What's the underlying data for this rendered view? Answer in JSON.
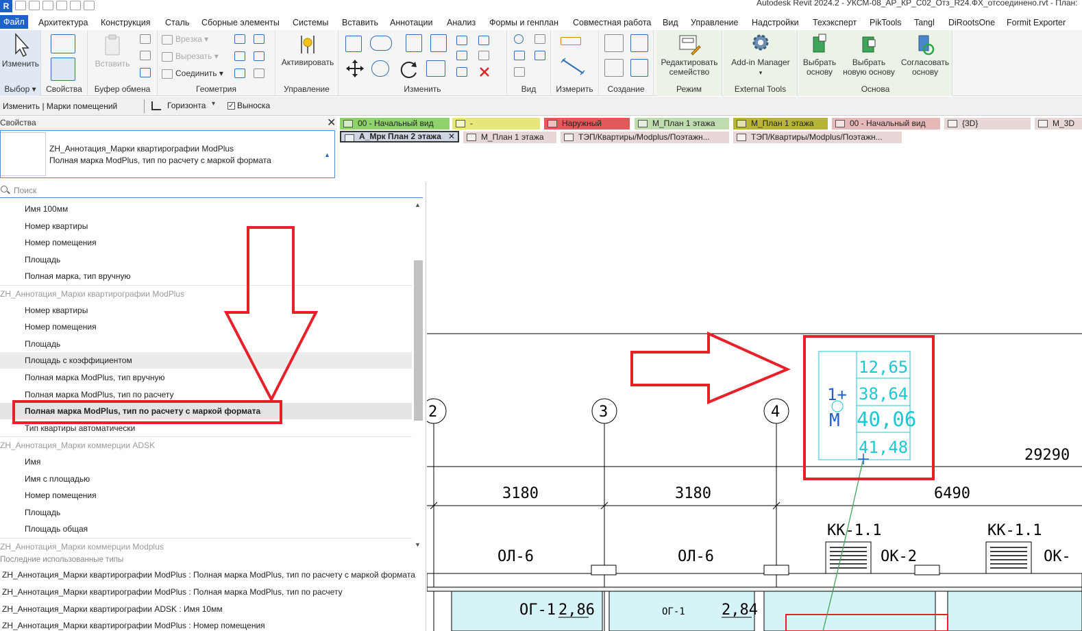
{
  "titlebar": {
    "app_logo": "R",
    "title": "Autodesk Revit 2024.2 - УКСМ-08_АР_КР_С02_Отз_R24.ФХ_отсоединено.rvt - План:"
  },
  "menu": {
    "tabs": [
      "Файл",
      "Архитектура",
      "Конструкция",
      "Сталь",
      "Сборные элементы",
      "Системы",
      "Вставить",
      "Аннотации",
      "Анализ",
      "Формы и генплан",
      "Совместная работа",
      "Вид",
      "Управление",
      "Надстройки",
      "Техэксперт",
      "PikTools",
      "Tangl",
      "DiRootsOne",
      "Formit Exporter"
    ]
  },
  "ribbon": {
    "select": {
      "modify_label": "Изменить",
      "panel_label": "Выбор ▾"
    },
    "properties": {
      "panel_label": "Свойства"
    },
    "clipboard": {
      "paste_label": "Вставить",
      "panel_label": "Буфер обмена"
    },
    "geometry": {
      "cut_label": "Врезка",
      "uncut_label": "Вырезать",
      "join_label": "Соединить",
      "panel_label": "Геометрия"
    },
    "control": {
      "activate_label": "Активировать",
      "panel_label": "Управление"
    },
    "modify": {
      "panel_label": "Изменить"
    },
    "view": {
      "panel_label": "Вид"
    },
    "measure": {
      "panel_label": "Измерить"
    },
    "create": {
      "panel_label": "Создание"
    },
    "mode": {
      "edit_family_label": "Редактировать семейство",
      "panel_label": "Режим"
    },
    "external": {
      "addin_label": "Add-in Manager",
      "panel_label": "External Tools"
    },
    "basis": {
      "pick_label": "Выбрать основу",
      "pick_new_label": "Выбрать новую основу",
      "reconcile_label": "Согласовать основу",
      "panel_label": "Основа"
    }
  },
  "optbar": {
    "context": "Изменить | Марки помещений",
    "orientation": "Горизонта",
    "leader_label": "Выноска",
    "leader_checked": true
  },
  "properties": {
    "title": "Свойства",
    "family": "ZH_Аннотация_Марки квартирографии ModPlus",
    "type": "Полная марка ModPlus, тип по расчету с маркой формата",
    "search_placeholder": "Поиск",
    "items": [
      {
        "label": "Имя 100мм",
        "kind": "item"
      },
      {
        "label": "Номер квартиры",
        "kind": "item"
      },
      {
        "label": "Номер помещения",
        "kind": "item"
      },
      {
        "label": "Площадь",
        "kind": "item"
      },
      {
        "label": "Полная марка, тип вручную",
        "kind": "item"
      },
      {
        "label": "ZH_Аннотация_Марки квартирографии ModPlus",
        "kind": "group"
      },
      {
        "label": "Номер квартиры",
        "kind": "item"
      },
      {
        "label": "Номер помещения",
        "kind": "item"
      },
      {
        "label": "Площадь",
        "kind": "item"
      },
      {
        "label": "Площадь с коэффициентом",
        "kind": "hover"
      },
      {
        "label": "Полная марка ModPlus, тип вручную",
        "kind": "item"
      },
      {
        "label": "Полная марка ModPlus, тип по расчету",
        "kind": "item"
      },
      {
        "label": "Полная марка ModPlus, тип по расчету с маркой формата",
        "kind": "selected"
      },
      {
        "label": "Тип квартиры автоматически",
        "kind": "item"
      },
      {
        "label": "ZH_Аннотация_Марки коммерции ADSK",
        "kind": "group"
      },
      {
        "label": "Имя",
        "kind": "item"
      },
      {
        "label": "Имя с площадью",
        "kind": "item"
      },
      {
        "label": "Номер помещения",
        "kind": "item"
      },
      {
        "label": "Площадь",
        "kind": "item"
      },
      {
        "label": "Площадь общая",
        "kind": "item"
      },
      {
        "label": "ZH_Аннотация_Марки коммерции Modplus",
        "kind": "group"
      }
    ],
    "recent_label": "Последние использованные типы",
    "recent": [
      "ZH_Аннотация_Марки квартирографии ModPlus : Полная марка ModPlus, тип по расчету с маркой формата",
      "ZH_Аннотация_Марки квартирографии ModPlus : Полная марка ModPlus, тип по расчету",
      "ZH_Аннотация_Марки квартирографии ADSK : Имя 10мм",
      "ZH_Аннотация_Марки квартирографии ModPlus : Номер помещения"
    ]
  },
  "view_tabs": {
    "row1": [
      {
        "label": "00 - Начальный вид",
        "color": "#8fd16a"
      },
      {
        "label": "-",
        "color": "#e6e67a"
      },
      {
        "label": "Наружный",
        "color": "#e05a5a"
      },
      {
        "label": "М_План 1 этажа",
        "color": "#bfdcb0"
      },
      {
        "label": "М_План 1 этажа",
        "color": "#b8b43a"
      },
      {
        "label": "00 - Начальный вид",
        "color": "#e6b8b8"
      },
      {
        "label": "{3D}",
        "color": "#e8d7d7"
      },
      {
        "label": "М_3D",
        "color": "#e8d7d7"
      }
    ],
    "row2": [
      {
        "label": "А_Мрк План 2 этажа",
        "color": "#cfd6e3",
        "active": true
      },
      {
        "label": "М_План 1 этажа",
        "color": "#e8d7d7"
      },
      {
        "label": "ТЭП/Квартиры/Modplus/Поэтажн...",
        "color": "#e8d7d7"
      },
      {
        "label": "ТЭП/Квартиры/Modplus/Поэтажн...",
        "color": "#e8d7d7"
      }
    ]
  },
  "drawing": {
    "grid_labels": [
      "2",
      "3",
      "4"
    ],
    "dimensions": [
      "3180",
      "3180",
      "6490",
      "29290"
    ],
    "walls": [
      "КК-1.1",
      "ОК-2",
      "КК-1.1",
      "ОК-"
    ],
    "openings": [
      "ОЛ-6",
      "ОЛ-6"
    ],
    "room_tags": [
      "ОГ-1",
      "ОГ-1"
    ],
    "room_areas": [
      "2,86",
      "2,84"
    ],
    "tag": {
      "apartment": "1+",
      "letter": "М",
      "areas": [
        "12,65",
        "38,64",
        "40,06",
        "41,48"
      ]
    }
  },
  "annotation_color": "#e8202a",
  "accent_color": "#1e62c9"
}
